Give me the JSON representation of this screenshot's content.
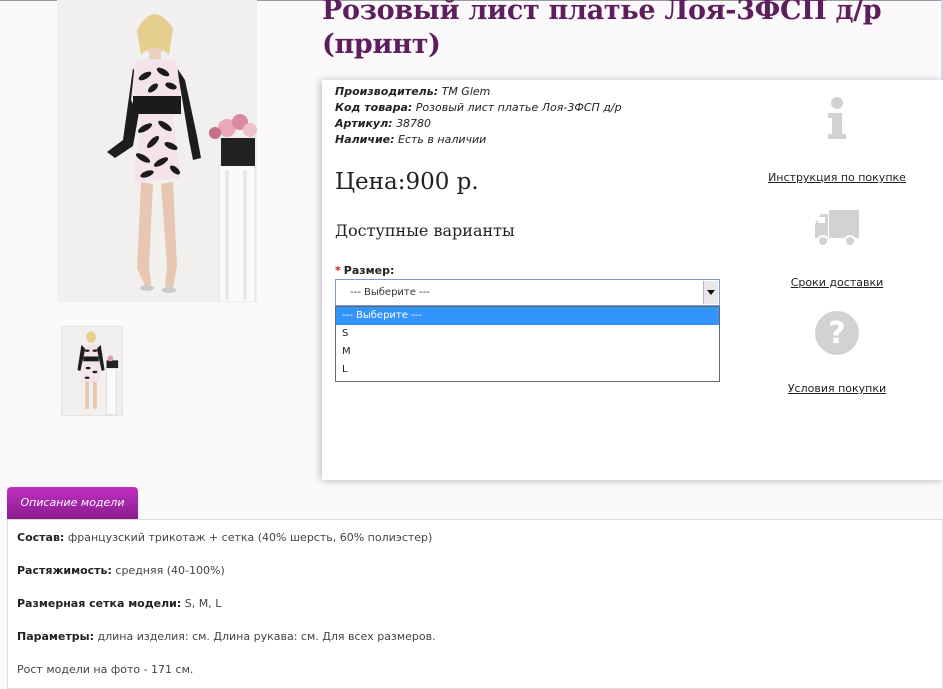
{
  "product": {
    "title": "Розовый лист платье Лоя-3ФСП д/р (принт)",
    "specs": [
      {
        "label": "Производитель:",
        "value": "TM Glem"
      },
      {
        "label": "Код товара:",
        "value": "Розовый лист платье Лоя-3ФСП д/р"
      },
      {
        "label": "Артикул:",
        "value": "38780"
      },
      {
        "label": "Наличие:",
        "value": "Есть в наличии"
      }
    ],
    "price": "Цена:900 р.",
    "options_title": "Доступные варианты",
    "size_label": "Размер:",
    "size_required_mark": "*",
    "select_value": "--- Выберите ---",
    "size_options": [
      "--- Выберите ---",
      "S",
      "M",
      "L"
    ]
  },
  "side_links": {
    "instruction": "Инструкция по покупке",
    "delivery": "Сроки доставки",
    "conditions": "Условия покупки"
  },
  "description": {
    "tab_label": "Описание модели",
    "rows": [
      {
        "label": "Состав:",
        "value": "французский трикотаж + сетка (40% шерсть, 60% полиэстер)"
      },
      {
        "label": "Растяжимость:",
        "value": "средняя (40-100%)"
      },
      {
        "label": "Размерная сетка модели:",
        "value": "S, M, L"
      },
      {
        "label": "Параметры:",
        "value": "длина изделия: см. Длина рукава: см. Для всех размеров."
      },
      {
        "label": "",
        "value": "Рост модели на фото - 171 см."
      }
    ]
  },
  "colors": {
    "title": "#5c1f5c",
    "tab_gradient_top": "#c030c0",
    "tab_gradient_bottom": "#8a1c8f",
    "selected_option": "#3394fd",
    "icon_gray": "#d2d2d2"
  }
}
